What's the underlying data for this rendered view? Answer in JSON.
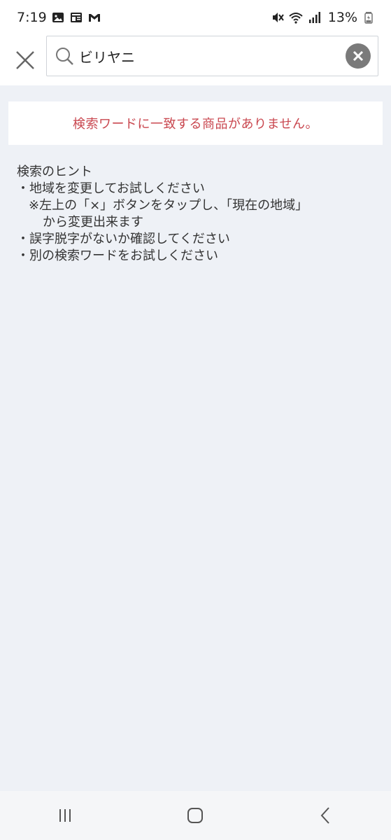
{
  "status_bar": {
    "time": "7:19",
    "battery": "13%",
    "left_icons": [
      "gallery-icon",
      "news-icon",
      "gmail-icon"
    ],
    "right_icons": [
      "mute-icon",
      "wifi-icon",
      "signal-icon",
      "battery-icon"
    ]
  },
  "search": {
    "value": "ビリヤニ",
    "close_icon": "close-icon",
    "search_icon": "search-icon",
    "clear_icon": "clear-icon"
  },
  "message": {
    "text": "検索ワードに一致する商品がありません。",
    "color": "#c9474f"
  },
  "hints": {
    "title": "検索のヒント",
    "line1": "・地域を変更してお試しください",
    "line2": "※左上の「×」ボタンをタップし、「現在の地域」",
    "line3": "から変更出来ます",
    "line4": "・誤字脱字がないか確認してください",
    "line5": "・別の検索ワードをお試しください"
  },
  "nav": {
    "recent_icon": "recent-apps-icon",
    "home_icon": "home-icon",
    "back_icon": "back-icon"
  }
}
